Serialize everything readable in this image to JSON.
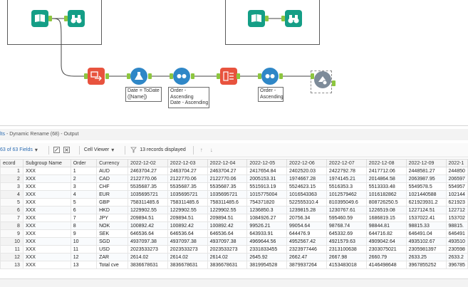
{
  "canvas": {
    "annotations": {
      "date_formula": "Date = ToDate\n([Name])",
      "sort_1": "Order -\nAscending\nDate - Ascending",
      "sort_2": "Order -\nAscending"
    }
  },
  "results": {
    "title_prefix": "lts",
    "title": "- Dynamic Rename (68) - Output",
    "fields_selector": "63 of 63 Fields",
    "cell_viewer": "Cell Viewer",
    "records_displayed": "13 records displayed"
  },
  "table": {
    "columns": [
      "ecord",
      "Subgroup Name",
      "Order",
      "Currency",
      "2022-12-02",
      "2022-12-03",
      "2022-12-04",
      "2022-12-05",
      "2022-12-06",
      "2022-12-07",
      "2022-12-08",
      "2022-12-09",
      "2022-1"
    ],
    "rows": [
      [
        "1",
        "XXX",
        "1",
        "AUD",
        "2463704.27",
        "2463704.27",
        "2463704.27",
        "2417654.84",
        "2402520.03",
        "2422792.78",
        "2417712.06",
        "2448581.27",
        "244850"
      ],
      [
        "2",
        "XXX",
        "2",
        "CAD",
        "2122770.06",
        "2122770.06",
        "2122770.06",
        "2005153.31",
        "1974667.28",
        "1974145.21",
        "2014864.58",
        "2063987.95",
        "206597"
      ],
      [
        "3",
        "XXX",
        "3",
        "CHF",
        "5535687.35",
        "5535687.35",
        "5535687.35",
        "5515913.19",
        "5524623.15",
        "5516353.3",
        "5513333.48",
        "5549578.5",
        "554957"
      ],
      [
        "4",
        "XXX",
        "4",
        "EUR",
        "1035695721",
        "1035695721",
        "1035695721",
        "1015775004",
        "1016543363",
        "1012579462",
        "1016182862",
        "1021440588",
        "102144"
      ],
      [
        "5",
        "XXX",
        "5",
        "GBP",
        "758311485.6",
        "758311485.6",
        "758311485.6",
        "754371820",
        "522555310.4",
        "810395049.6",
        "808726250.5",
        "621923931.2",
        "621923"
      ],
      [
        "6",
        "XXX",
        "6",
        "HKD",
        "1229902.55",
        "1229902.55",
        "1229902.55",
        "1236850.3",
        "1239815.28",
        "1230767.61",
        "1226519.08",
        "1227124.51",
        "122712"
      ],
      [
        "7",
        "XXX",
        "7",
        "JPY",
        "209894.51",
        "209894.51",
        "209894.51",
        "1084926.27",
        "20756.34",
        "595460.59",
        "1686819.15",
        "1537022.41",
        "153702"
      ],
      [
        "8",
        "XXX",
        "8",
        "NOK",
        "100892.42",
        "100892.42",
        "100892.42",
        "99526.21",
        "99054.64",
        "98768.74",
        "98844.81",
        "98815.33",
        "98815."
      ],
      [
        "9",
        "XXX",
        "9",
        "SEK",
        "646536.64",
        "646536.64",
        "646536.64",
        "643933.91",
        "644476.9",
        "645332.69",
        "644716.82",
        "646491.04",
        "646491"
      ],
      [
        "10",
        "XXX",
        "10",
        "SGD",
        "4937097.38",
        "4937097.38",
        "4937097.38",
        "4969644.56",
        "4952567.42",
        "4921579.63",
        "4909042.64",
        "4935102.67",
        "493510"
      ],
      [
        "11",
        "XXX",
        "11",
        "USD",
        "2023533273",
        "2023533273",
        "2023533273",
        "2331833455",
        "2323977446",
        "2313100638",
        "2303075021",
        "2305981397",
        "230598"
      ],
      [
        "12",
        "XXX",
        "12",
        "ZAR",
        "2614.02",
        "2614.02",
        "2614.02",
        "2645.92",
        "2662.47",
        "2667.98",
        "2660.79",
        "2633.25",
        "2633.2"
      ],
      [
        "13",
        "XXX",
        "13",
        "Total cve",
        "3836678631",
        "3836678631",
        "3836678631",
        "3819954528",
        "3879937264",
        "4153483018",
        "4146498648",
        "3967855252",
        "396785"
      ]
    ]
  }
}
